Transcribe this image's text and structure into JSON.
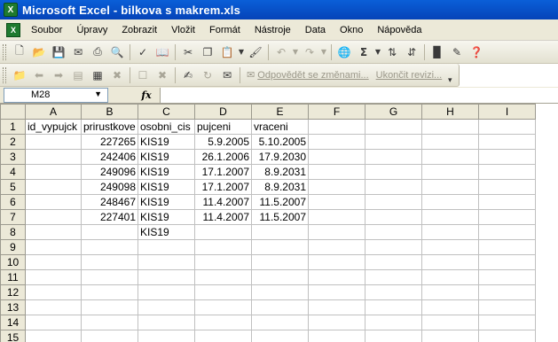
{
  "window": {
    "title": "Microsoft Excel - bilkova s makrem.xls"
  },
  "menu": {
    "items": [
      "Soubor",
      "Úpravy",
      "Zobrazit",
      "Vložit",
      "Formát",
      "Nástroje",
      "Data",
      "Okno",
      "Nápověda"
    ]
  },
  "toolbar_review": {
    "reply_label": "Odpovědět se změnami...",
    "end_label": "Ukončit revizi..."
  },
  "formula_bar": {
    "cell_ref": "M28",
    "fx_label": "fx",
    "content": ""
  },
  "sheet": {
    "columns": [
      "A",
      "B",
      "C",
      "D",
      "E",
      "F",
      "G",
      "H",
      "I"
    ],
    "rows": [
      {
        "num": "1",
        "cells": [
          "id_vypujck",
          "prirustkove",
          "osobni_cis",
          "pujceni",
          "vraceni",
          "",
          "",
          "",
          ""
        ]
      },
      {
        "num": "2",
        "cells": [
          "",
          "227265",
          "KIS19",
          "5.9.2005",
          "5.10.2005",
          "",
          "",
          "",
          ""
        ]
      },
      {
        "num": "3",
        "cells": [
          "",
          "242406",
          "KIS19",
          "26.1.2006",
          "17.9.2030",
          "",
          "",
          "",
          ""
        ]
      },
      {
        "num": "4",
        "cells": [
          "",
          "249096",
          "KIS19",
          "17.1.2007",
          "8.9.2031",
          "",
          "",
          "",
          ""
        ]
      },
      {
        "num": "5",
        "cells": [
          "",
          "249098",
          "KIS19",
          "17.1.2007",
          "8.9.2031",
          "",
          "",
          "",
          ""
        ]
      },
      {
        "num": "6",
        "cells": [
          "",
          "248467",
          "KIS19",
          "11.4.2007",
          "11.5.2007",
          "",
          "",
          "",
          ""
        ]
      },
      {
        "num": "7",
        "cells": [
          "",
          "227401",
          "KIS19",
          "11.4.2007",
          "11.5.2007",
          "",
          "",
          "",
          ""
        ]
      },
      {
        "num": "8",
        "cells": [
          "",
          "",
          "KIS19",
          "",
          "",
          "",
          "",
          "",
          ""
        ]
      },
      {
        "num": "9",
        "cells": [
          "",
          "",
          "",
          "",
          "",
          "",
          "",
          "",
          ""
        ]
      },
      {
        "num": "10",
        "cells": [
          "",
          "",
          "",
          "",
          "",
          "",
          "",
          "",
          ""
        ]
      },
      {
        "num": "11",
        "cells": [
          "",
          "",
          "",
          "",
          "",
          "",
          "",
          "",
          ""
        ]
      },
      {
        "num": "12",
        "cells": [
          "",
          "",
          "",
          "",
          "",
          "",
          "",
          "",
          ""
        ]
      },
      {
        "num": "13",
        "cells": [
          "",
          "",
          "",
          "",
          "",
          "",
          "",
          "",
          ""
        ]
      },
      {
        "num": "14",
        "cells": [
          "",
          "",
          "",
          "",
          "",
          "",
          "",
          "",
          ""
        ]
      },
      {
        "num": "15",
        "cells": [
          "",
          "",
          "",
          "",
          "",
          "",
          "",
          "",
          ""
        ]
      }
    ]
  }
}
